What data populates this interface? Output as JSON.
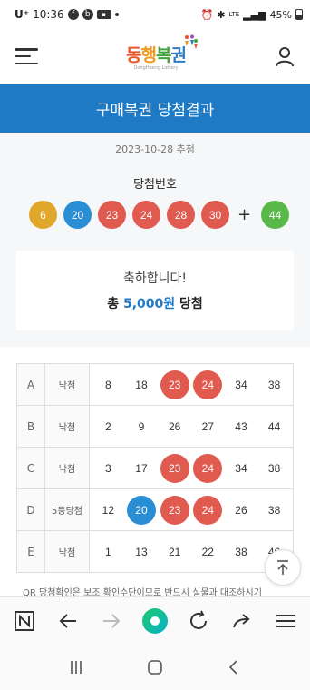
{
  "status_bar": {
    "carrier": "U⁺",
    "time": "10:36",
    "network": "LTE",
    "battery": "45%"
  },
  "header": {
    "logo_text": [
      "동",
      "행",
      "복",
      "권"
    ],
    "logo_sub": "DongHaeng Lottery"
  },
  "page_title": "구매복권 당첨결과",
  "draw": {
    "date": "2023-10-28 추첨",
    "winning_label": "당첨번호",
    "numbers": [
      {
        "n": "6",
        "color": "#e1a72b"
      },
      {
        "n": "20",
        "color": "#2a8ed5"
      },
      {
        "n": "23",
        "color": "#e05a4f"
      },
      {
        "n": "24",
        "color": "#e05a4f"
      },
      {
        "n": "28",
        "color": "#e05a4f"
      },
      {
        "n": "30",
        "color": "#e05a4f"
      }
    ],
    "plus": "+",
    "bonus": {
      "n": "44",
      "color": "#58b848"
    }
  },
  "congrats": {
    "message": "축하합니다!",
    "prefix": "총",
    "amount": "5,000원",
    "suffix": "당첨"
  },
  "tickets": [
    {
      "label": "A",
      "result": "낙첨",
      "numbers": [
        {
          "n": "8"
        },
        {
          "n": "18"
        },
        {
          "n": "23",
          "hit": "#e05a4f"
        },
        {
          "n": "24",
          "hit": "#e05a4f"
        },
        {
          "n": "34"
        },
        {
          "n": "38"
        }
      ]
    },
    {
      "label": "B",
      "result": "낙첨",
      "numbers": [
        {
          "n": "2"
        },
        {
          "n": "9"
        },
        {
          "n": "26"
        },
        {
          "n": "27"
        },
        {
          "n": "43"
        },
        {
          "n": "44"
        }
      ]
    },
    {
      "label": "C",
      "result": "낙첨",
      "numbers": [
        {
          "n": "3"
        },
        {
          "n": "17"
        },
        {
          "n": "23",
          "hit": "#e05a4f"
        },
        {
          "n": "24",
          "hit": "#e05a4f"
        },
        {
          "n": "34"
        },
        {
          "n": "38"
        }
      ]
    },
    {
      "label": "D",
      "result": "5등당첨",
      "numbers": [
        {
          "n": "12"
        },
        {
          "n": "20",
          "hit": "#2a8ed5"
        },
        {
          "n": "23",
          "hit": "#e05a4f"
        },
        {
          "n": "24",
          "hit": "#e05a4f"
        },
        {
          "n": "26"
        },
        {
          "n": "38"
        }
      ]
    },
    {
      "label": "E",
      "result": "낙첨",
      "numbers": [
        {
          "n": "1"
        },
        {
          "n": "13"
        },
        {
          "n": "21"
        },
        {
          "n": "22"
        },
        {
          "n": "38"
        },
        {
          "n": "40"
        }
      ]
    }
  ],
  "notice": "QR 당첨확인은 보조 확인수단이므로 반드시 실물과 대조하시기",
  "colors": {
    "primary": "#1f7ac6",
    "hit_red": "#e05a4f",
    "hit_blue": "#2a8ed5"
  }
}
